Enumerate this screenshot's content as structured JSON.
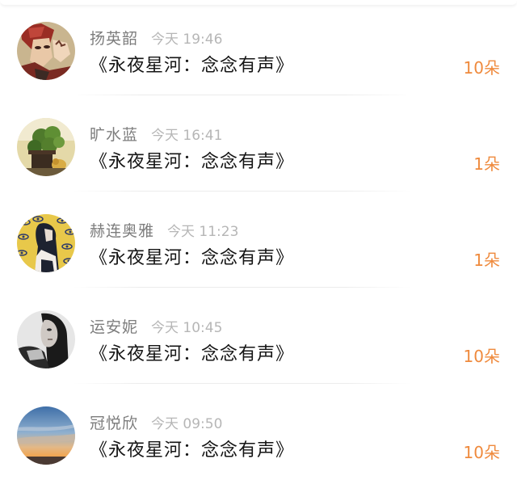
{
  "gift_list": {
    "items": [
      {
        "name": "扬英韶",
        "time": "今天 19:46",
        "title": "《永夜星河：念念有声》",
        "amount": "10朵",
        "avatar": "anime-character-avatar"
      },
      {
        "name": "旷水蓝",
        "time": "今天 16:41",
        "title": "《永夜星河：念念有声》",
        "amount": "1朵",
        "avatar": "potted-plant-avatar"
      },
      {
        "name": "赫连奥雅",
        "time": "今天 11:23",
        "title": "《永夜星河：念念有声》",
        "amount": "1朵",
        "avatar": "illustrated-woman-avatar"
      },
      {
        "name": "运安妮",
        "time": "今天 10:45",
        "title": "《永夜星河：念念有声》",
        "amount": "10朵",
        "avatar": "black-white-portrait-avatar"
      },
      {
        "name": "冠悦欣",
        "time": "今天 09:50",
        "title": "《永夜星河：念念有声》",
        "amount": "10朵",
        "avatar": "sunset-sky-avatar"
      }
    ]
  },
  "colors": {
    "amount": "#ef8a3d",
    "name": "#7d7d7d",
    "time": "#b6b6b6",
    "title": "#151515"
  }
}
